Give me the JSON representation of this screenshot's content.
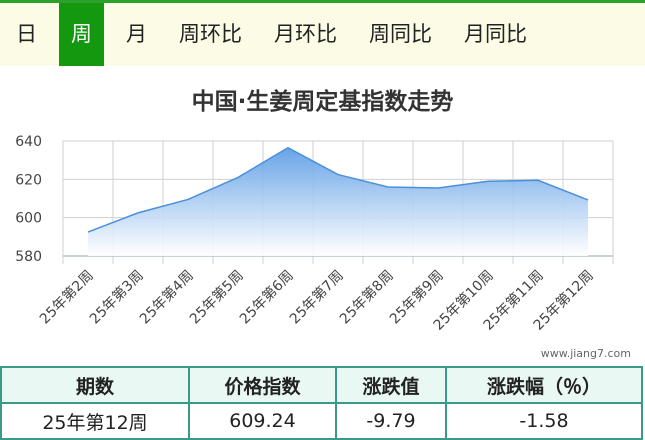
{
  "tabs": [
    {
      "label": "日",
      "active": false
    },
    {
      "label": "周",
      "active": true
    },
    {
      "label": "月",
      "active": false
    },
    {
      "label": "周环比",
      "active": false
    },
    {
      "label": "月环比",
      "active": false
    },
    {
      "label": "周同比",
      "active": false
    },
    {
      "label": "月同比",
      "active": false
    }
  ],
  "colors": {
    "accent": "#13980f",
    "line": "#4a90d9",
    "fill_top": "#5f9fe6",
    "grid": "#cccccc"
  },
  "watermark": "www.jiang7.com",
  "chart_data": {
    "type": "area",
    "title": "中国·生姜周定基指数走势",
    "categories": [
      "25年第2周",
      "25年第3周",
      "25年第4周",
      "25年第5周",
      "25年第6周",
      "25年第7周",
      "25年第8周",
      "25年第9周",
      "25年第10周",
      "25年第11周",
      "25年第12周"
    ],
    "series": [
      {
        "values": [
          592.5,
          602.5,
          609.5,
          621,
          636.5,
          622.5,
          616,
          615.5,
          619,
          619.5,
          609.24
        ]
      }
    ],
    "ylim": [
      580,
      640
    ],
    "yticks": [
      580,
      600,
      620,
      640
    ],
    "grid": true
  },
  "table": {
    "headers": [
      "期数",
      "价格指数",
      "涨跌值",
      "涨跌幅（％）"
    ],
    "row": [
      "25年第12周",
      "609.24",
      "-9.79",
      "-1.58"
    ]
  }
}
